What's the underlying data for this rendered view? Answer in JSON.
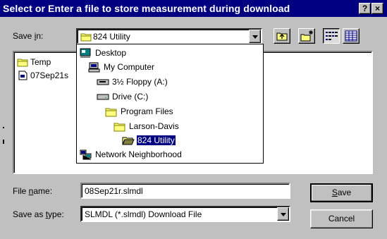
{
  "window": {
    "title": "Select or Enter a file to store measurement during download",
    "help_button": "?",
    "close_button": "×"
  },
  "save_in": {
    "label_pre": "Save ",
    "label_u": "i",
    "label_post": "n:",
    "value": "824 Utility"
  },
  "file_list": {
    "items": [
      {
        "name": "Temp",
        "icon": "folder-icon"
      },
      {
        "name": "07Sep21s",
        "icon": "file-icon"
      }
    ]
  },
  "location_dropdown": {
    "items": [
      {
        "label": "Desktop",
        "icon": "desktop-icon"
      },
      {
        "label": "My Computer",
        "icon": "computer-icon"
      },
      {
        "label": "3½ Floppy (A:)",
        "icon": "floppy-drive-icon"
      },
      {
        "label": "Drive (C:)",
        "icon": "hard-drive-icon"
      },
      {
        "label": "Program Files",
        "icon": "folder-icon"
      },
      {
        "label": "Larson-Davis",
        "icon": "folder-icon"
      },
      {
        "label": "824 Utility",
        "icon": "open-folder-icon",
        "selected": true
      },
      {
        "label": "Network Neighborhood",
        "icon": "network-icon"
      }
    ]
  },
  "file_name": {
    "label_pre": "File ",
    "label_u": "n",
    "label_post": "ame:",
    "value": "08Sep21r.slmdl"
  },
  "save_as_type": {
    "label_pre": "Save as ",
    "label_u": "t",
    "label_post": "ype:",
    "value": "SLMDL (*.slmdl) Download File"
  },
  "buttons": {
    "save_u": "S",
    "save_rest": "ave",
    "cancel": "Cancel"
  },
  "colors": {
    "titlebar": "#000080",
    "face": "#c0c0c0",
    "selection": "#000080"
  }
}
